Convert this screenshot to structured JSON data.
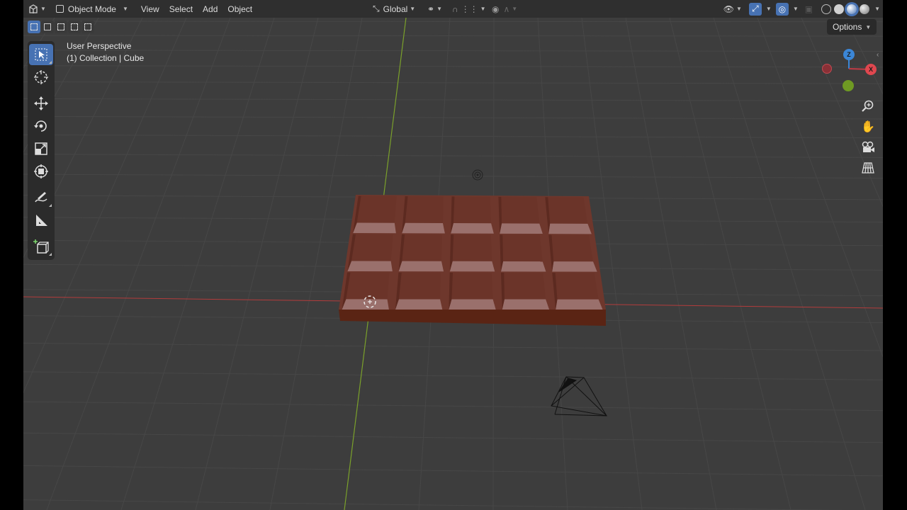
{
  "header": {
    "editor_type_icon": "3d-viewport-icon",
    "mode": "Object Mode",
    "menus": [
      "View",
      "Select",
      "Add",
      "Object"
    ],
    "orientation": "Global"
  },
  "viewport": {
    "perspective": "User Perspective",
    "collection": "(1) Collection | Cube",
    "options_label": "Options"
  },
  "gizmo": {
    "z": "Z",
    "x": "X"
  },
  "toolbar": {
    "tools": [
      "select-box-icon",
      "cursor-icon",
      "move-icon",
      "rotate-icon",
      "scale-icon",
      "transform-icon",
      "annotate-icon",
      "measure-icon",
      "add-cube-icon"
    ]
  },
  "colors": {
    "accent": "#4772b3",
    "viewport_bg": "#3d3d3d",
    "x_axis": "#c44",
    "y_axis": "#7aaa2a",
    "chocolate": "#6b3428"
  }
}
